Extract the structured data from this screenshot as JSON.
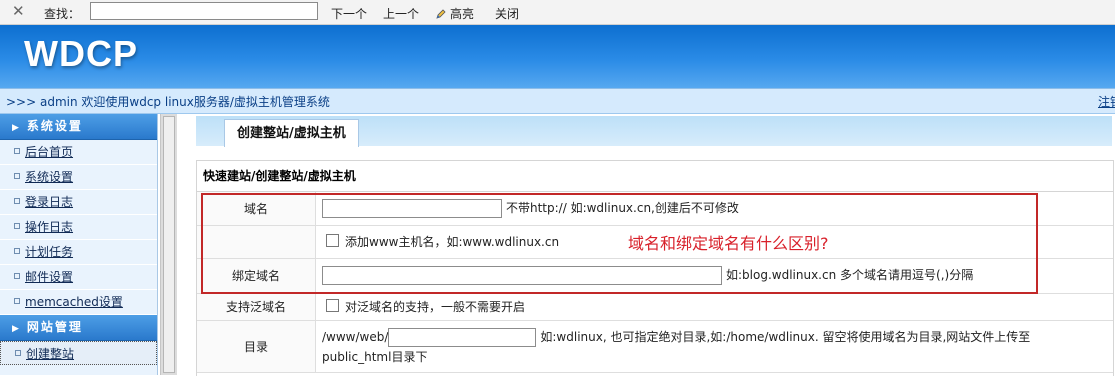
{
  "find_bar": {
    "close_glyph": "✕",
    "label": "查找：",
    "input_value": "",
    "next": "下一个",
    "prev": "上一个",
    "highlight": "高亮",
    "close": "关闭"
  },
  "header": {
    "logo": "WDCP"
  },
  "welcome": {
    "text": ">>> admin 欢迎使用wdcp linux服务器/虚拟主机管理系统",
    "logout": "注销"
  },
  "sidebar": {
    "categories": [
      {
        "title": "系统设置",
        "items": [
          "后台首页",
          "系统设置",
          "登录日志",
          "操作日志",
          "计划任务",
          "邮件设置",
          "memcached设置"
        ]
      },
      {
        "title": "网站管理",
        "items": [
          "创建整站"
        ]
      }
    ]
  },
  "main": {
    "tab": "创建整站/虚拟主机",
    "panel_title": "快速建站/创建整站/虚拟主机",
    "rows": {
      "domain": {
        "label": "域名",
        "value": "",
        "hint": "不带http:// 如:wdlinux.cn,创建后不可修改"
      },
      "www": {
        "text": "添加www主机名，如:www.wdlinux.cn"
      },
      "bind": {
        "label": "绑定域名",
        "value": "",
        "hint": "如:blog.wdlinux.cn 多个域名请用逗号(,)分隔"
      },
      "wildcard": {
        "label": "支持泛域名",
        "text": "对泛域名的支持，一般不需要开启"
      },
      "dir": {
        "label": "目录",
        "prefix": "/www/web/",
        "value": "",
        "hint": "如:wdlinux, 也可指定绝对目录,如:/home/wdlinux. 留空将使用域名为目录,网站文件上传至",
        "hint2": "public_html目录下"
      }
    }
  },
  "annotation": {
    "text": "域名和绑定域名有什么区别?"
  },
  "colors": {
    "header": "#1a7ddc",
    "sidebar_category": "#2a79cc",
    "annotation": "#d8202a",
    "highlight_box": "#c22828"
  },
  "icons": [
    "close-icon",
    "highlight-pen-icon",
    "triangle-right-icon",
    "square-bullet-icon",
    "checkbox-icon"
  ]
}
